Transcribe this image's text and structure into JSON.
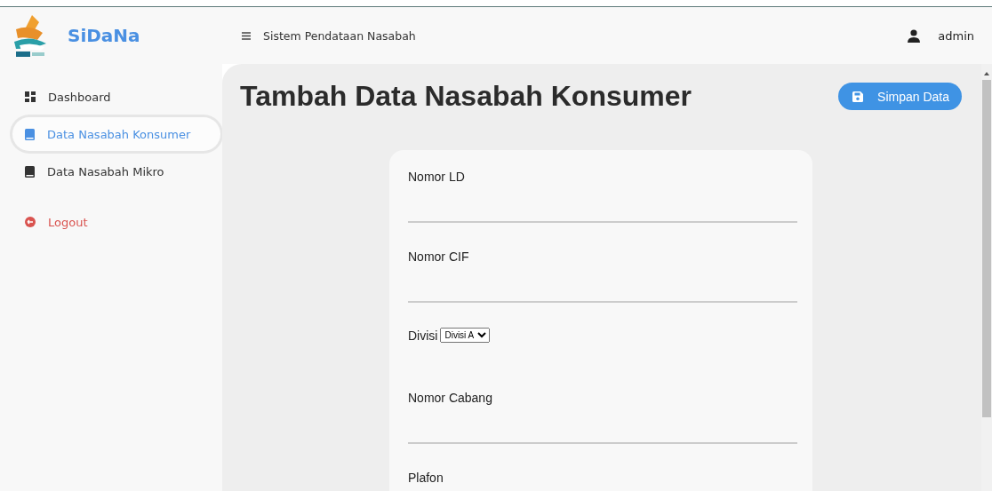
{
  "header": {
    "app_name": "SiDaNa",
    "title": "Sistem Pendataan Nasabah",
    "user": "admin"
  },
  "sidebar": {
    "items": [
      {
        "label": "Dashboard",
        "kind": "dashboard",
        "selected": false
      },
      {
        "label": "Data Nasabah Konsumer",
        "kind": "book",
        "selected": true
      },
      {
        "label": "Data Nasabah Mikro",
        "kind": "book",
        "selected": false
      },
      {
        "label": "Logout",
        "kind": "logout",
        "selected": false
      }
    ]
  },
  "page": {
    "title": "Tambah Data Nasabah Konsumer",
    "save_button": "Simpan Data"
  },
  "form": {
    "fields": [
      {
        "label": "Nomor LD",
        "kind": "text"
      },
      {
        "label": "Nomor CIF",
        "kind": "text"
      },
      {
        "label": "Divisi",
        "kind": "select",
        "value": "Divisi A"
      },
      {
        "label": "Nomor Cabang",
        "kind": "text"
      },
      {
        "label": "Plafon",
        "kind": "label"
      }
    ]
  }
}
